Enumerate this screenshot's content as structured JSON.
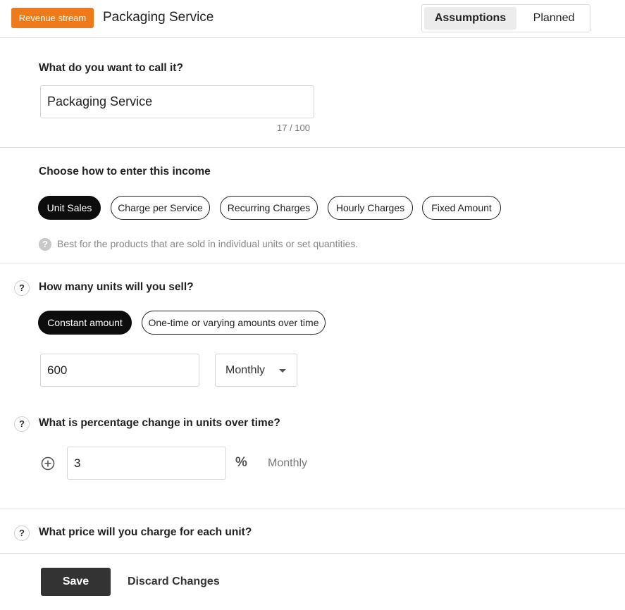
{
  "header": {
    "badge": "Revenue stream",
    "title": "Packaging Service",
    "tabs": [
      {
        "label": "Assumptions",
        "active": true
      },
      {
        "label": "Planned",
        "active": false
      }
    ]
  },
  "name_section": {
    "question": "What do you want to call it?",
    "value": "Packaging Service",
    "counter": "17 / 100"
  },
  "income_section": {
    "question": "Choose how to enter this income",
    "options": [
      {
        "label": "Unit Sales",
        "selected": true
      },
      {
        "label": "Charge per Service",
        "selected": false
      },
      {
        "label": "Recurring Charges",
        "selected": false
      },
      {
        "label": "Hourly Charges",
        "selected": false
      },
      {
        "label": "Fixed Amount",
        "selected": false
      }
    ],
    "hint_icon": "?",
    "hint": "Best for the products that are sold in individual units or set quantities."
  },
  "units_section": {
    "help_icon": "?",
    "question": "How many units will you sell?",
    "modes": [
      {
        "label": "Constant amount",
        "selected": true
      },
      {
        "label": "One-time or varying amounts over time",
        "selected": false
      }
    ],
    "amount": "600",
    "frequency": "Monthly"
  },
  "change_section": {
    "help_icon": "?",
    "question": "What is percentage change in units over time?",
    "value": "3",
    "percent_symbol": "%",
    "period": "Monthly"
  },
  "price_section": {
    "help_icon": "?",
    "question": "What price will you charge for each unit?"
  },
  "footer": {
    "save": "Save",
    "discard": "Discard Changes"
  },
  "colors": {
    "accent": "#ef7a1a",
    "selected_pill": "#0d0d0d",
    "save_button": "#333333"
  }
}
